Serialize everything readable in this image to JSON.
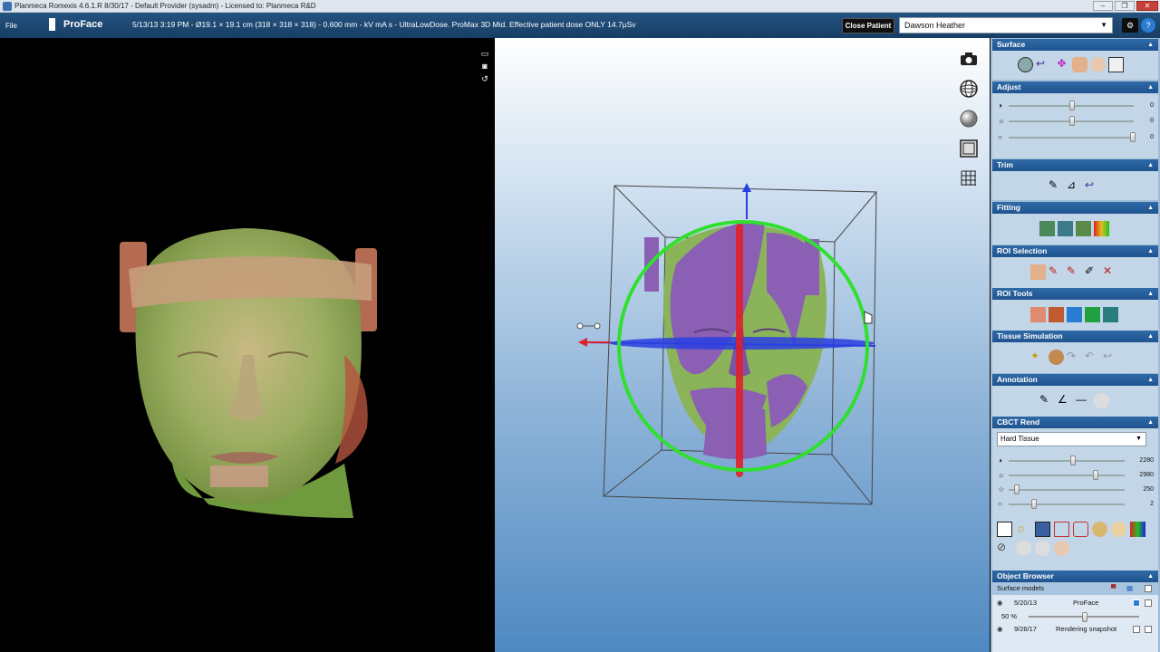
{
  "window": {
    "title": "Planmeca Romexis 4.6.1.R  8/30/17 - Default Provider (sysadm) - Licensed to: Planmeca R&D"
  },
  "topbar": {
    "file_label": "File",
    "product": "ProFace",
    "info": "5/13/13 3:19 PM - Ø19.1 × 19.1 cm (318 × 318 × 318) - 0.600 mm -  kV  mA  s - UltraLowDose. ProMax 3D Mid. Effective patient dose ONLY 14.7µSv",
    "close_patient": "Close Patient",
    "patient": "Dawson Heather"
  },
  "panel": {
    "surface": {
      "title": "Surface"
    },
    "adjust": {
      "title": "Adjust",
      "values": [
        "0",
        "0",
        "0"
      ],
      "levels": [
        0.5,
        0.5,
        1.0
      ]
    },
    "trim": {
      "title": "Trim"
    },
    "fitting": {
      "title": "Fitting"
    },
    "roi_selection": {
      "title": "ROI Selection"
    },
    "roi_tools": {
      "title": "ROI Tools"
    },
    "tissue_simulation": {
      "title": "Tissue Simulation"
    },
    "annotation": {
      "title": "Annotation"
    },
    "cbct_rend": {
      "title": "CBCT Rend",
      "preset": "Hard Tissue",
      "values": [
        "2280",
        "2980",
        "250",
        "2"
      ],
      "levels": [
        0.55,
        0.75,
        0.05,
        0.2
      ]
    },
    "object_browser": {
      "title": "Object Browser",
      "group": "Surface models",
      "rows": [
        {
          "date": "5/20/13",
          "name": "ProFace",
          "opacity": "50 %",
          "opacity_level": 0.5
        },
        {
          "date": "9/26/17",
          "name": "Rendering snapshot"
        }
      ]
    }
  },
  "colors": {
    "accent": "#1f5490",
    "panel_bg": "#9fbbd5",
    "face_green": "#8ab35a",
    "face_purple": "#8a5fb4",
    "ring_green": "#2fe02f",
    "axis_red": "#e0202a",
    "axis_blue": "#2a3fe0"
  }
}
